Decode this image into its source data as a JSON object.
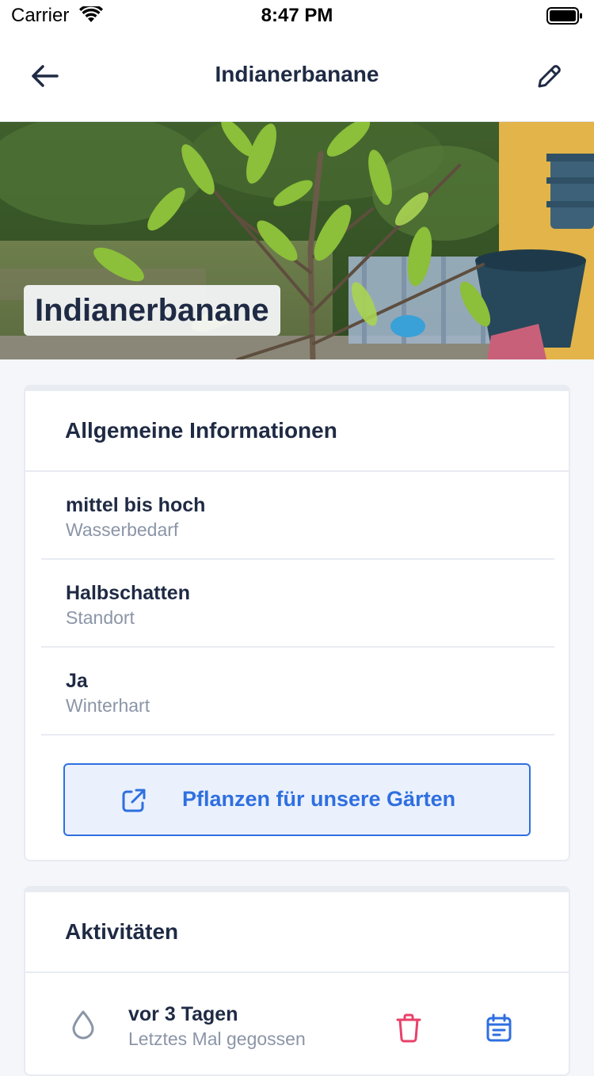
{
  "status_bar": {
    "carrier": "Carrier",
    "time": "8:47 PM"
  },
  "nav": {
    "title": "Indianerbanane",
    "back_icon": "arrow-left-icon",
    "edit_icon": "pencil-icon"
  },
  "hero": {
    "label": "Indianerbanane"
  },
  "general_info": {
    "heading": "Allgemeine Informationen",
    "rows": [
      {
        "value": "mittel bis hoch",
        "label": "Wasserbedarf"
      },
      {
        "value": "Halbschatten",
        "label": "Standort"
      },
      {
        "value": "Ja",
        "label": "Winterhart"
      }
    ],
    "link_button": {
      "label": "Pflanzen für unsere Gärten",
      "icon": "external-link-icon"
    }
  },
  "activities": {
    "heading": "Aktivitäten",
    "items": [
      {
        "value": "vor 3 Tagen",
        "label": "Letztes Mal gegossen",
        "icon": "water-drop-icon"
      }
    ]
  },
  "colors": {
    "accent": "#2f6fe0",
    "danger": "#e8416a",
    "text": "#1f2a44",
    "muted": "#8b95a7"
  }
}
